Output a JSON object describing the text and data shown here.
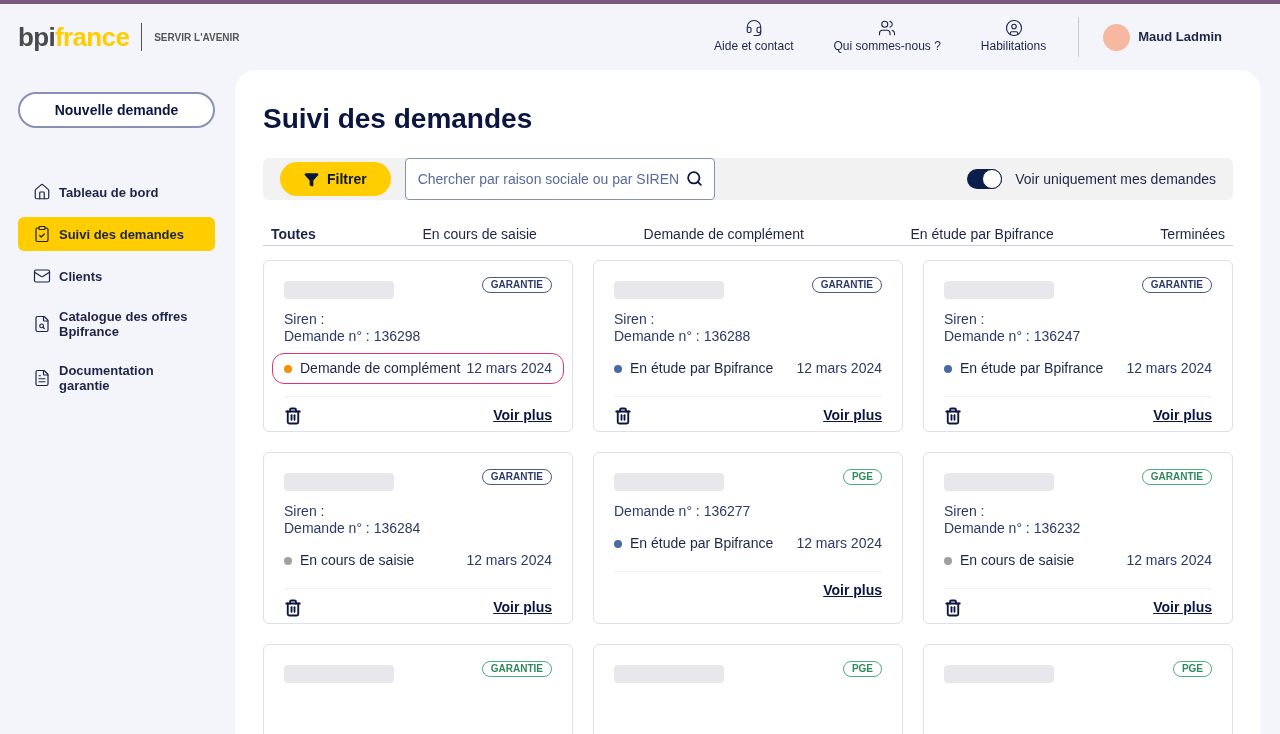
{
  "brand": {
    "logo_dark": "bpi",
    "logo_light": "france",
    "tagline": "SERVIR L'AVENIR"
  },
  "header_links": [
    {
      "label": "Aide et contact"
    },
    {
      "label": "Qui sommes-nous ?"
    },
    {
      "label": "Habilitations"
    }
  ],
  "user": {
    "name": "Maud Ladmin"
  },
  "sidebar": {
    "new_button": "Nouvelle demande",
    "items": [
      {
        "label": "Tableau de bord",
        "selected": false
      },
      {
        "label": "Suivi des demandes",
        "selected": true
      },
      {
        "label": "Clients",
        "selected": false
      },
      {
        "label": "Catalogue des offres Bpifrance",
        "selected": false
      },
      {
        "label": "Documentation garantie",
        "selected": false
      }
    ]
  },
  "page_title": "Suivi des demandes",
  "toolbar": {
    "filter_button": "Filtrer",
    "search_placeholder": "Chercher par raison sociale ou par SIREN",
    "toggle": {
      "label": "Voir uniquement mes demandes",
      "on": true
    }
  },
  "tabs": [
    {
      "label": "Toutes",
      "selected": true
    },
    {
      "label": "En cours de saisie",
      "selected": false
    },
    {
      "label": "Demande de complément",
      "selected": false
    },
    {
      "label": "En étude par Bpifrance",
      "selected": false
    },
    {
      "label": "Terminées",
      "selected": false
    }
  ],
  "cards": [
    {
      "tag": "GARANTIE",
      "kind": "garantie",
      "siren_label": "Siren :",
      "request": "Demande n° : 136298",
      "status": "Demande de complément",
      "color": "#f39200",
      "date": "12 mars 2024",
      "deletable": true,
      "highlighted": true,
      "link": "Voir plus"
    },
    {
      "tag": "GARANTIE",
      "kind": "garantie",
      "siren_label": "Siren :",
      "request": "Demande n° : 136288",
      "status": "En étude par Bpifrance",
      "color": "#4a6aa5",
      "date": "12 mars 2024",
      "deletable": true,
      "highlighted": false,
      "link": "Voir plus"
    },
    {
      "tag": "GARANTIE",
      "kind": "garantie",
      "siren_label": "Siren :",
      "request": "Demande n° : 136247",
      "status": "En étude par Bpifrance",
      "color": "#4a6aa5",
      "date": "12 mars 2024",
      "deletable": true,
      "highlighted": false,
      "link": "Voir plus"
    },
    {
      "tag": "GARANTIE",
      "kind": "garantie",
      "siren_label": "Siren :",
      "request": "Demande n° : 136284",
      "status": "En cours de saisie",
      "color": "#a0a0a0",
      "date": "12 mars 2024",
      "deletable": true,
      "highlighted": false,
      "link": "Voir plus"
    },
    {
      "tag": "PGE",
      "kind": "pge",
      "request": "Demande n° : 136277",
      "status": "En étude par Bpifrance",
      "color": "#4a6aa5",
      "date": "12 mars 2024",
      "deletable": false,
      "highlighted": false,
      "link": "Voir plus"
    },
    {
      "tag": "GARANTIE",
      "kind": "pge",
      "siren_label": "Siren :",
      "request": "Demande n° : 136232",
      "status": "En cours de saisie",
      "color": "#a0a0a0",
      "date": "12 mars 2024",
      "deletable": true,
      "highlighted": false,
      "link": "Voir plus"
    },
    {
      "tag": "GARANTIE",
      "kind": "pge"
    },
    {
      "tag": "PGE",
      "kind": "pge"
    },
    {
      "tag": "PGE",
      "kind": "pge"
    }
  ]
}
